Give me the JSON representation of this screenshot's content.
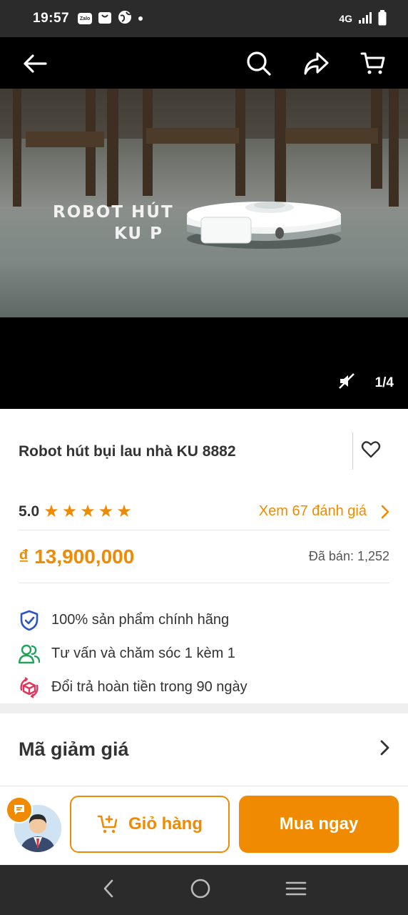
{
  "status_bar": {
    "time": "19:57",
    "network": "4G",
    "icons": [
      "zalo-icon",
      "shopping-bag-icon",
      "globe-icon",
      "dot-icon",
      "signal-icon",
      "battery-icon"
    ],
    "zalo_label": "Zalo"
  },
  "media": {
    "caption_line1": "ROBOT HÚT",
    "caption_line2": "KU P",
    "pager": "1/4"
  },
  "product": {
    "title": "Robot hút bụi lau nhà KU 8882",
    "rating": "5.0",
    "stars": 5,
    "reviews_link": "Xem 67 đánh giá",
    "price": "₫ 13,900,000",
    "sold": "Đã bán: 1,252"
  },
  "guarantees": [
    {
      "icon": "shield-check-icon",
      "text": "100% sản phẩm chính hãng"
    },
    {
      "icon": "users-icon",
      "text": "Tư vấn và chăm sóc 1 kèm 1"
    },
    {
      "icon": "refund-box-icon",
      "text": "Đổi trả hoàn tiền trong 90 ngày"
    }
  ],
  "coupon": {
    "title": "Mã giảm giá"
  },
  "actions": {
    "cart_label": "Giỏ hàng",
    "buy_label": "Mua ngay"
  },
  "colors": {
    "accent": "#f08a00",
    "dark_bar": "#2b2b2b",
    "shield_blue": "#2b54c8",
    "users_green": "#1fa35a",
    "refund_red": "#e0355b"
  }
}
